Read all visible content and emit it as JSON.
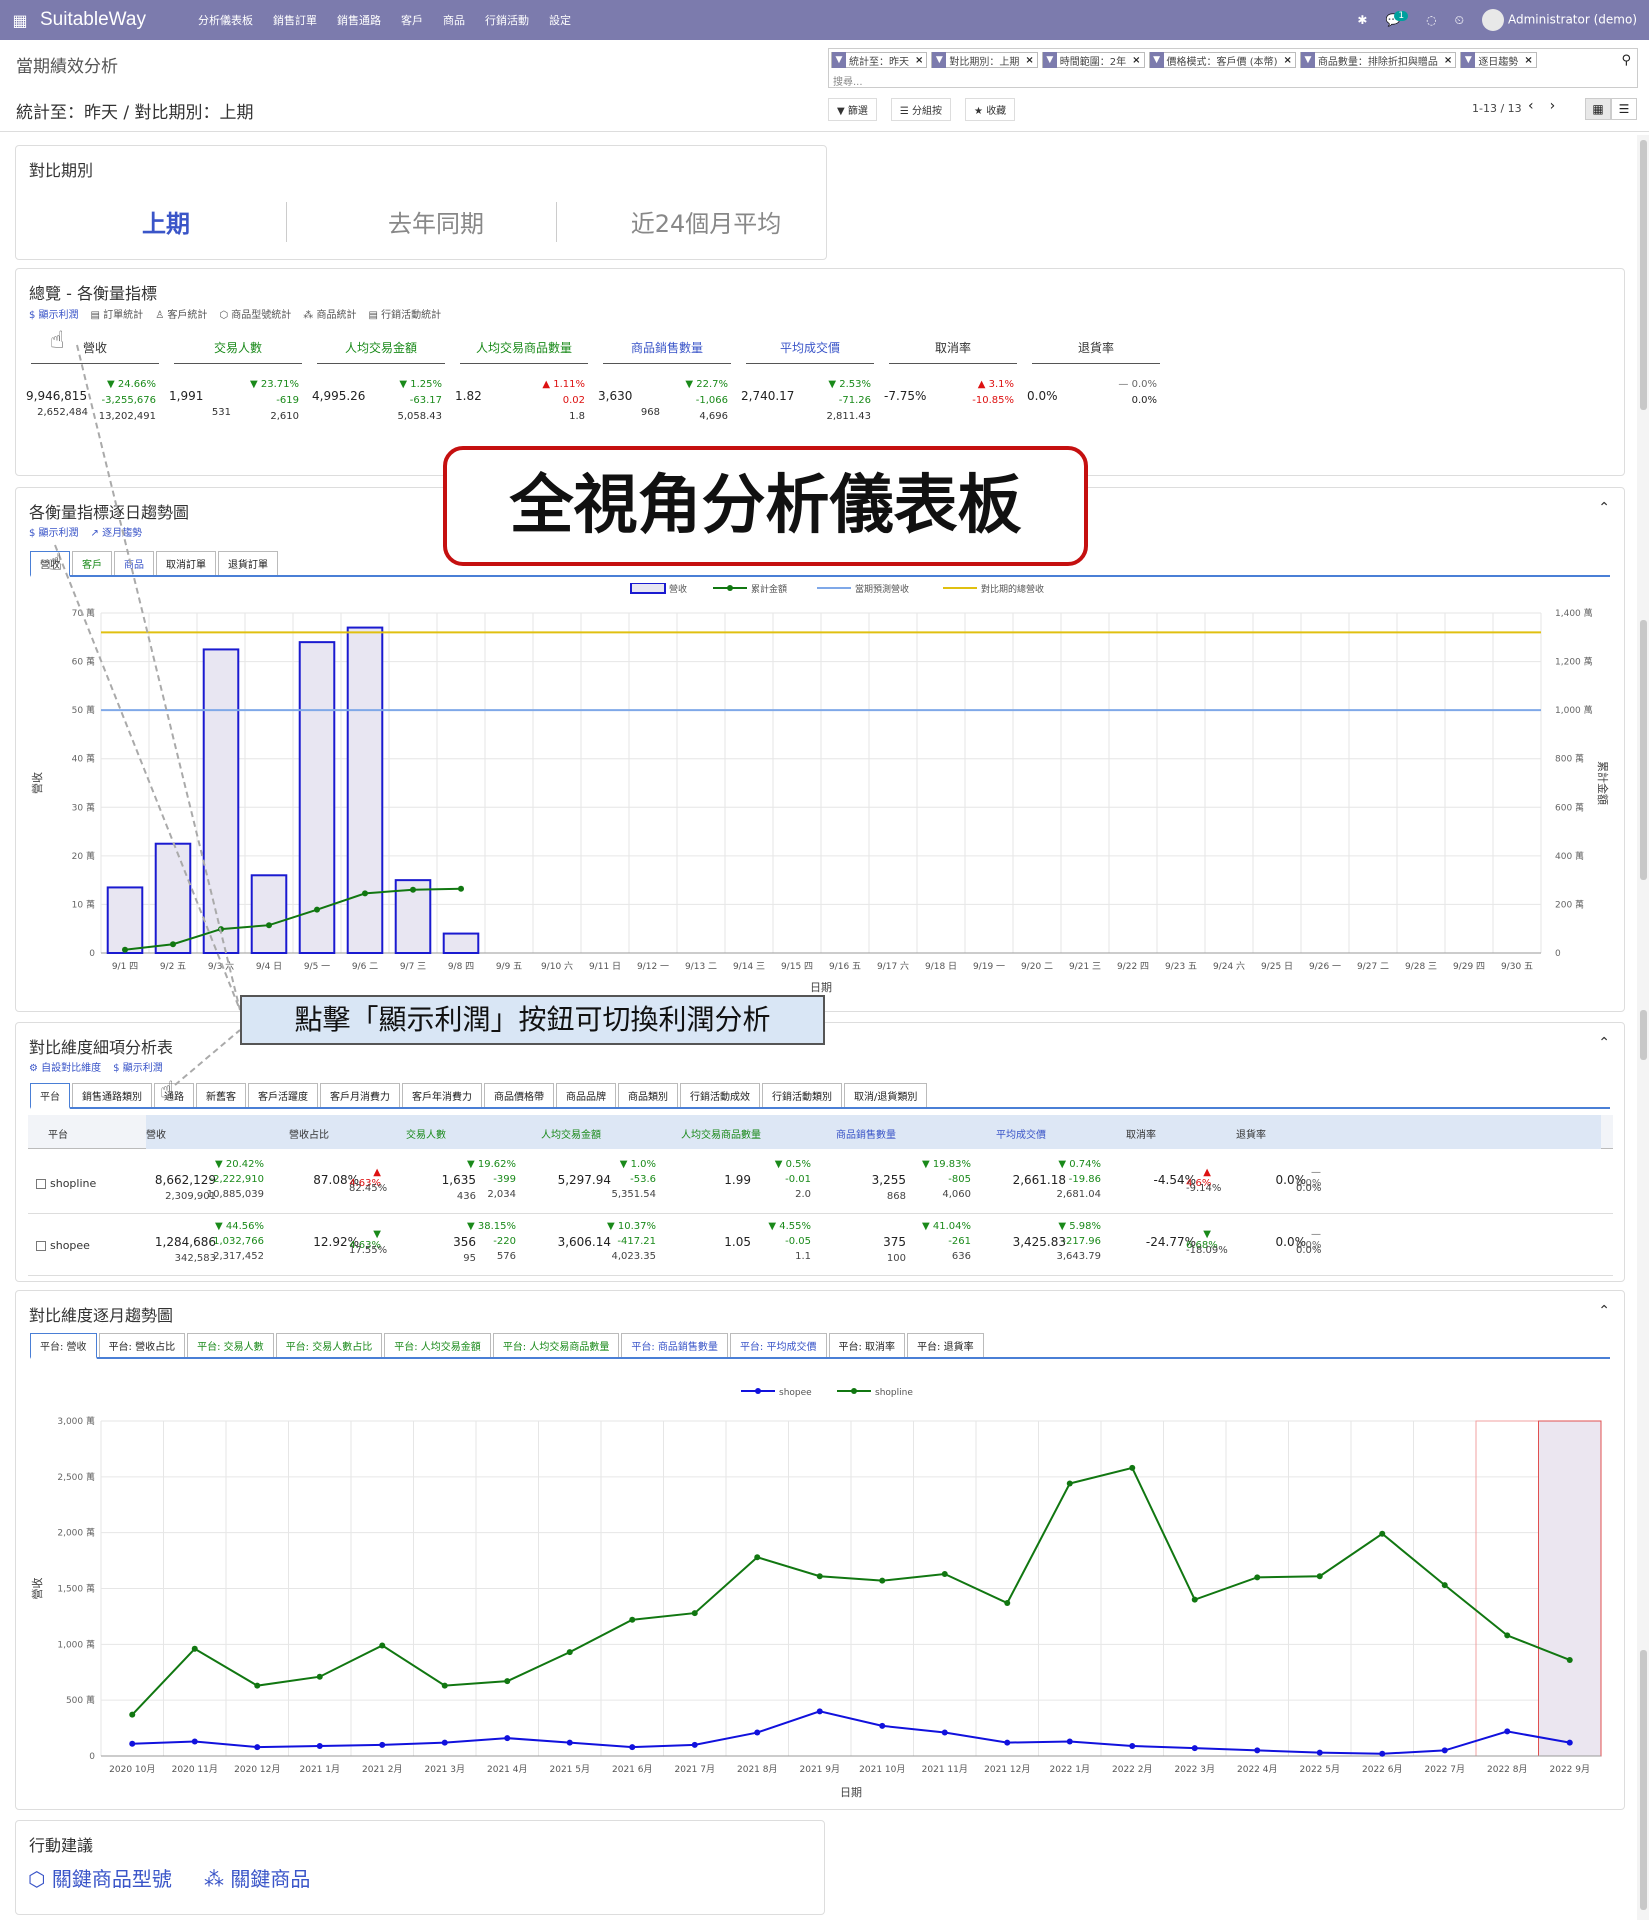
{
  "nav": {
    "brand": "SuitableWay",
    "menu": [
      "分析儀表板",
      "銷售訂單",
      "銷售通路",
      "客戶",
      "商品",
      "行銷活動",
      "設定"
    ],
    "chat_count": "1",
    "user": "Administrator (demo)"
  },
  "control": {
    "breadcrumb": "當期績效分析",
    "subtitle": "統計至：昨天 / 對比期別：上期",
    "facets": [
      "統計至：昨天",
      "對比期別：上期",
      "時間範圍：2年",
      "價格模式：客戶價 (本幣)",
      "商品數量：排除折扣與贈品",
      "逐日趨勢"
    ],
    "search_placeholder": "搜尋...",
    "filter_btn": "篩選",
    "group_btn": "分組按",
    "fav_btn": "收藏",
    "pager": "1-13 / 13"
  },
  "period_card": {
    "title": "對比期別",
    "options": [
      "上期",
      "去年同期",
      "近24個月平均"
    ]
  },
  "overview": {
    "title": "總覽 - 各衡量指標",
    "links": [
      "顯示利潤",
      "訂單統計",
      "客戶統計",
      "商品型號統計",
      "商品統計",
      "行銷活動統計"
    ],
    "kpis": [
      {
        "label": "營收",
        "main": "9,946,815",
        "sub": "2,652,484",
        "pct": "▼ 24.66%",
        "diff": "-3,255,676",
        "prev": "13,202,491",
        "dir": "dn",
        "color": "#333"
      },
      {
        "label": "交易人數",
        "main": "1,991",
        "sub": "531",
        "pct": "▼ 23.71%",
        "diff": "-619",
        "prev": "2,610",
        "dir": "dn",
        "color": "#1a8a1a"
      },
      {
        "label": "人均交易金額",
        "main": "4,995.26",
        "sub": "",
        "pct": "▼ 1.25%",
        "diff": "-63.17",
        "prev": "5,058.43",
        "dir": "dn",
        "color": "#1a8a1a"
      },
      {
        "label": "人均交易商品數量",
        "main": "1.82",
        "sub": "",
        "pct": "▲ 1.11%",
        "diff": "0.02",
        "prev": "1.8",
        "dir": "up",
        "color": "#1a8a1a"
      },
      {
        "label": "商品銷售數量",
        "main": "3,630",
        "sub": "968",
        "pct": "▼ 22.7%",
        "diff": "-1,066",
        "prev": "4,696",
        "dir": "dn",
        "color": "#3a55c8"
      },
      {
        "label": "平均成交價",
        "main": "2,740.17",
        "sub": "",
        "pct": "▼ 2.53%",
        "diff": "-71.26",
        "prev": "2,811.43",
        "dir": "dn",
        "color": "#3a55c8"
      },
      {
        "label": "取消率",
        "main": "-7.75%",
        "sub": "",
        "pct": "▲ 3.1%",
        "diff": "-10.85%",
        "prev": "",
        "dir": "up",
        "color": "#333"
      },
      {
        "label": "退貨率",
        "main": "0.0%",
        "sub": "",
        "pct": "— 0.0%",
        "diff": "0.0%",
        "prev": "",
        "dir": "neu",
        "color": "#333"
      }
    ]
  },
  "daily": {
    "title": "各衡量指標逐日趨勢圖",
    "links": [
      "顯示利潤",
      "逐月趨勢"
    ],
    "tabs": [
      "營收",
      "客戶",
      "商品",
      "取消訂單",
      "退貨訂單"
    ]
  },
  "banner": "全視角分析儀表板",
  "callout": "點擊「顯示利潤」按鈕可切換利潤分析",
  "detail": {
    "title": "對比維度細項分析表",
    "links": [
      "自設對比維度",
      "顯示利潤"
    ],
    "tabs": [
      "平台",
      "銷售通路類別",
      "通路",
      "新舊客",
      "客戶活躍度",
      "客戶月消費力",
      "客戶年消費力",
      "商品價格帶",
      "商品品牌",
      "商品類別",
      "行銷活動成效",
      "行銷活動類別",
      "取消/退貨類別"
    ],
    "headers": [
      "平台",
      "營收",
      "營收占比",
      "交易人數",
      "人均交易金額",
      "人均交易商品數量",
      "商品銷售數量",
      "平均成交價",
      "取消率",
      "退貨率"
    ],
    "rows": [
      {
        "name": "shopline",
        "rev": "8,662,129",
        "rev_sub": "2,309,901",
        "rev_pct": "▼ 20.42%",
        "rev_diff": "-2,222,910",
        "rev_prev": "10,885,039",
        "share": "87.08%",
        "share_pct": "▲ 4.63%",
        "share_prev": "82.45%",
        "tx": "1,635",
        "tx_sub": "436",
        "tx_pct": "▼ 19.62%",
        "tx_diff": "-399",
        "tx_prev": "2,034",
        "avg": "5,297.94",
        "avg_pct": "▼ 1.0%",
        "avg_diff": "-53.6",
        "avg_prev": "5,351.54",
        "qty": "1.99",
        "qty_pct": "▼ 0.5%",
        "qty_diff": "-0.01",
        "qty_prev": "2.0",
        "sold": "3,255",
        "sold_sub": "868",
        "sold_pct": "▼ 19.83%",
        "sold_diff": "-805",
        "sold_prev": "4,060",
        "price": "2,661.18",
        "price_pct": "▼ 0.74%",
        "price_diff": "-19.86",
        "price_prev": "2,681.04",
        "cancel": "-4.54%",
        "cancel_pct": "▲ 4.6%",
        "cancel_prev": "-9.14%",
        "ret": "0.0%",
        "ret_pct": "— 0.0%",
        "ret_prev": "0.0%"
      },
      {
        "name": "shopee",
        "rev": "1,284,686",
        "rev_sub": "342,583",
        "rev_pct": "▼ 44.56%",
        "rev_diff": "-1,032,766",
        "rev_prev": "2,317,452",
        "share": "12.92%",
        "share_pct": "▼ 4.63%",
        "share_prev": "17.55%",
        "tx": "356",
        "tx_sub": "95",
        "tx_pct": "▼ 38.15%",
        "tx_diff": "-220",
        "tx_prev": "576",
        "avg": "3,606.14",
        "avg_pct": "▼ 10.37%",
        "avg_diff": "-417.21",
        "avg_prev": "4,023.35",
        "qty": "1.05",
        "qty_pct": "▼ 4.55%",
        "qty_diff": "-0.05",
        "qty_prev": "1.1",
        "sold": "375",
        "sold_sub": "100",
        "sold_pct": "▼ 41.04%",
        "sold_diff": "-261",
        "sold_prev": "636",
        "price": "3,425.83",
        "price_pct": "▼ 5.98%",
        "price_diff": "-217.96",
        "price_prev": "3,643.79",
        "cancel": "-24.77%",
        "cancel_pct": "▼ 6.68%",
        "cancel_prev": "-18.09%",
        "ret": "0.0%",
        "ret_pct": "— 0.0%",
        "ret_prev": "0.0%"
      }
    ]
  },
  "monthly": {
    "title": "對比維度逐月趨勢圖",
    "tabs": [
      "平台: 營收",
      "平台: 營收占比",
      "平台: 交易人數",
      "平台: 交易人數占比",
      "平台: 人均交易金額",
      "平台: 人均交易商品數量",
      "平台: 商品銷售數量",
      "平台: 平均成交價",
      "平台: 取消率",
      "平台: 退貨率"
    ]
  },
  "actions": {
    "title": "行動建議",
    "items": [
      "關鍵商品型號",
      "關鍵商品"
    ]
  },
  "chart_data": [
    {
      "type": "bar",
      "name": "daily",
      "categories": [
        "9/1 四",
        "9/2 五",
        "9/3 六",
        "9/4 日",
        "9/5 一",
        "9/6 二",
        "9/7 三",
        "9/8 四",
        "9/9 五",
        "9/10 六",
        "9/11 日",
        "9/12 一",
        "9/13 二",
        "9/14 三",
        "9/15 四",
        "9/16 五",
        "9/17 六",
        "9/18 日",
        "9/19 一",
        "9/20 二",
        "9/21 三",
        "9/22 四",
        "9/23 五",
        "9/24 六",
        "9/25 日",
        "9/26 一",
        "9/27 二",
        "9/28 三",
        "9/29 四",
        "9/30 五"
      ],
      "series": [
        {
          "name": "營收",
          "values": [
            13.5,
            22.5,
            62.5,
            16,
            64,
            67,
            15,
            4
          ]
        },
        {
          "name": "累計金額",
          "values": [
            13.5,
            36,
            98.5,
            114.5,
            178.5,
            245.5,
            260.5,
            264.5
          ]
        },
        {
          "name": "當期預測營收",
          "values": [
            1000
          ]
        },
        {
          "name": "對比期的總營收",
          "values": [
            1320
          ]
        }
      ],
      "xlabel": "日期",
      "ylabel": "營收",
      "y2label": "累計金額",
      "ylim": [
        0,
        70
      ],
      "y2lim": [
        0,
        1400
      ],
      "yticks": [
        "0",
        "10 萬",
        "20 萬",
        "30 萬",
        "40 萬",
        "50 萬",
        "60 萬",
        "70 萬"
      ],
      "y2ticks": [
        "0",
        "200 萬",
        "400 萬",
        "600 萬",
        "800 萬",
        "1,000 萬",
        "1,200 萬",
        "1,400 萬"
      ]
    },
    {
      "type": "line",
      "name": "monthly",
      "categories": [
        "2020 10月",
        "2020 11月",
        "2020 12月",
        "2021 1月",
        "2021 2月",
        "2021 3月",
        "2021 4月",
        "2021 5月",
        "2021 6月",
        "2021 7月",
        "2021 8月",
        "2021 9月",
        "2021 10月",
        "2021 11月",
        "2021 12月",
        "2022 1月",
        "2022 2月",
        "2022 3月",
        "2022 4月",
        "2022 5月",
        "2022 6月",
        "2022 7月",
        "2022 8月",
        "2022 9月"
      ],
      "series": [
        {
          "name": "shopee",
          "color": "#1111dd",
          "values": [
            110,
            130,
            80,
            90,
            100,
            120,
            160,
            120,
            80,
            100,
            210,
            400,
            270,
            210,
            120,
            130,
            90,
            70,
            50,
            30,
            20,
            50,
            220,
            120
          ]
        },
        {
          "name": "shopline",
          "color": "#117711",
          "values": [
            370,
            960,
            630,
            710,
            990,
            630,
            670,
            930,
            1220,
            1280,
            1780,
            1610,
            1570,
            1630,
            1370,
            2440,
            2580,
            1400,
            1600,
            1610,
            1990,
            1530,
            1080,
            860
          ]
        }
      ],
      "xlabel": "日期",
      "ylabel": "營收",
      "ylim": [
        0,
        3000
      ],
      "yticks": [
        "0",
        "500 萬",
        "1,000 萬",
        "1,500 萬",
        "2,000 萬",
        "2,500 萬",
        "3,000 萬"
      ]
    }
  ]
}
